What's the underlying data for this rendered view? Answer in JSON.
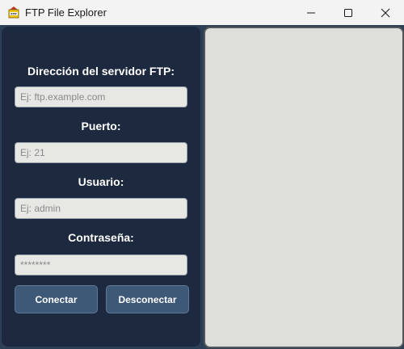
{
  "window": {
    "title": "FTP File Explorer",
    "icon": "ftp-app-icon"
  },
  "form": {
    "server_label": "Dirección del servidor FTP:",
    "server_placeholder": "Ej: ftp.example.com",
    "port_label": "Puerto:",
    "port_placeholder": "Ej: 21",
    "user_label": "Usuario:",
    "user_placeholder": "Ej: admin",
    "password_label": "Contraseña:",
    "password_placeholder": "********"
  },
  "buttons": {
    "connect": "Conectar",
    "disconnect": "Desconectar"
  },
  "colors": {
    "panel_bg": "#1d293e",
    "button_bg": "#3e5878",
    "file_area_bg": "#dedfda"
  }
}
